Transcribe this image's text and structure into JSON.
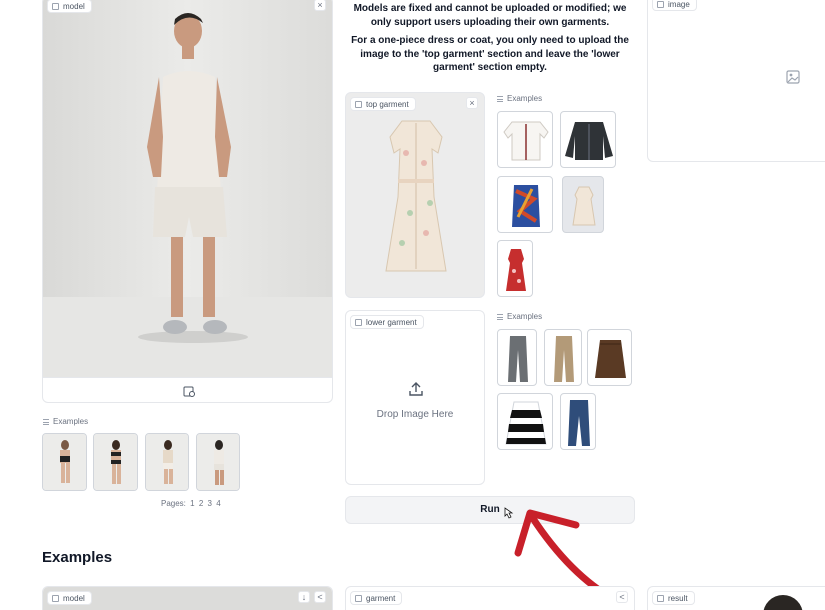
{
  "model_panel": {
    "label": "model",
    "close": "×",
    "upload_icon": "camera-upload-icon"
  },
  "model_examples": {
    "label": "Examples",
    "pages_label": "Pages:",
    "pages": [
      "1",
      "2",
      "3",
      "4"
    ]
  },
  "instructions": {
    "line1": "Models are fixed and cannot be uploaded or modified; we only support users uploading their own garments.",
    "line2": "For a one-piece dress or coat, you only need to upload the image to the 'top garment' section and leave the 'lower garment' section empty."
  },
  "top_garment": {
    "label": "top garment",
    "close": "×"
  },
  "top_examples": {
    "label": "Examples"
  },
  "lower_garment": {
    "label": "lower garment",
    "drop_text": "Drop Image Here",
    "upload_icon": "upload-icon"
  },
  "lower_examples": {
    "label": "Examples"
  },
  "image_panel": {
    "label": "image",
    "placeholder_icon": "image-icon"
  },
  "run_button": {
    "label": "Run"
  },
  "examples_section": {
    "title": "Examples"
  },
  "bottom_panels": {
    "model_label": "model",
    "garment_label": "garment",
    "result_label": "result"
  },
  "colors": {
    "annotation_arrow": "#c8202a",
    "panel_border": "#e5e7eb",
    "button_bg": "#f3f4f6"
  }
}
